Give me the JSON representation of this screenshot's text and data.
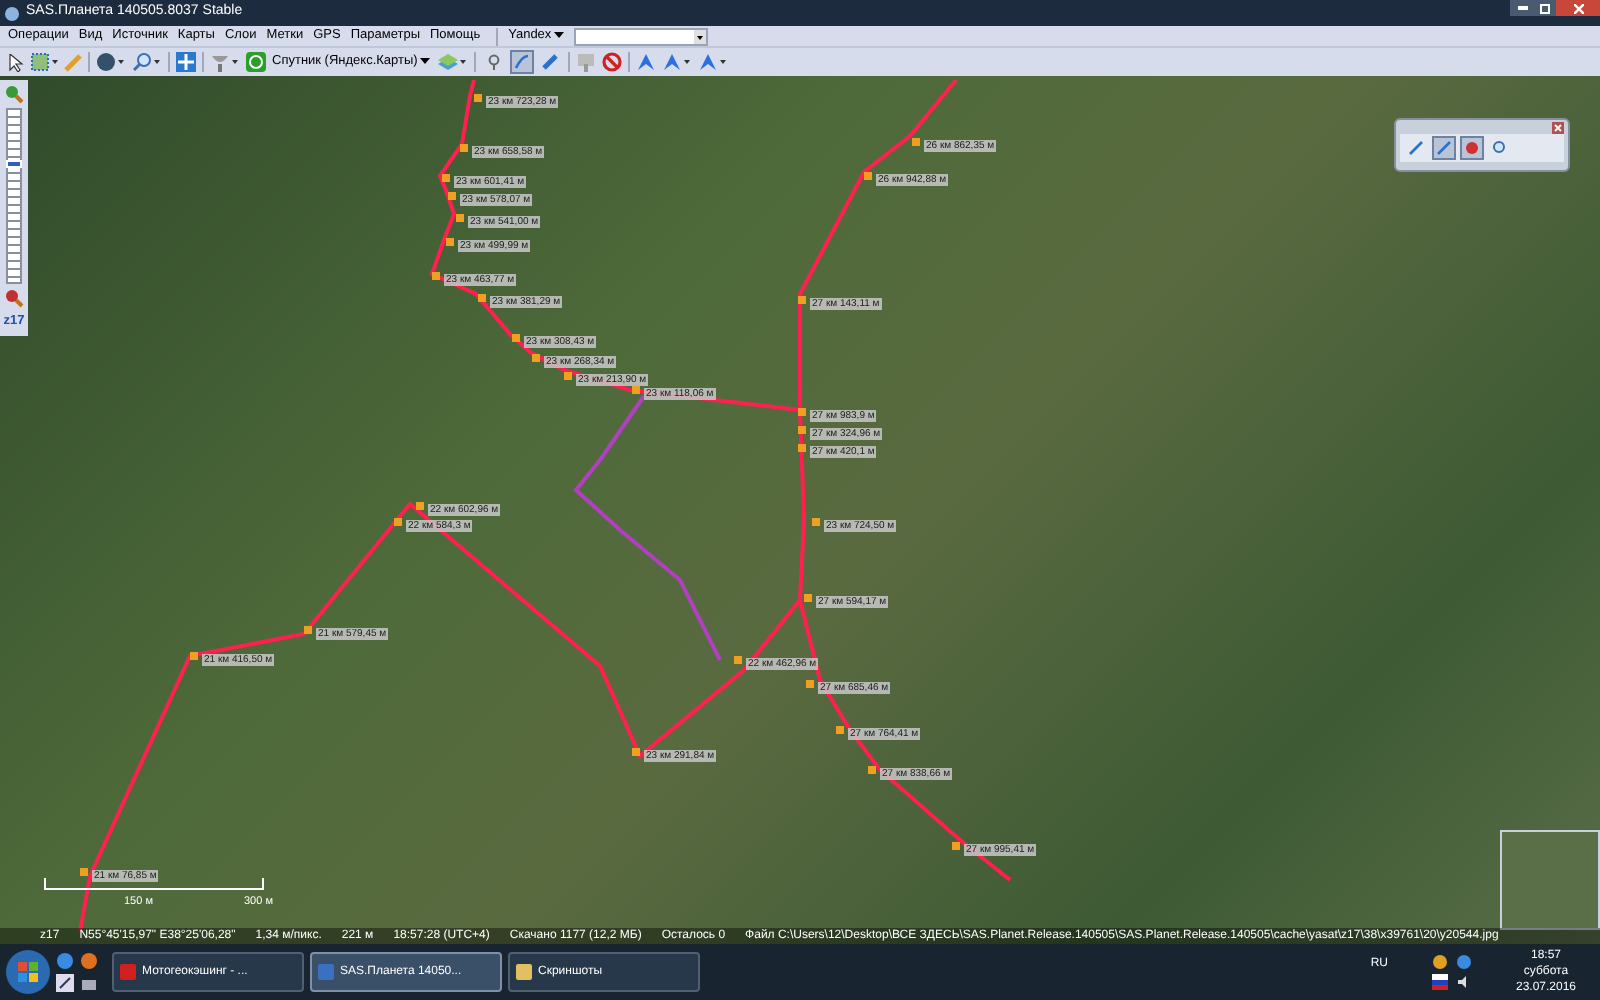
{
  "window": {
    "title": "SAS.Планета 140505.8037 Stable"
  },
  "menu": [
    "Операции",
    "Вид",
    "Источник",
    "Карты",
    "Слои",
    "Метки",
    "GPS",
    "Параметры",
    "Помощь"
  ],
  "search": {
    "provider": "Yandex"
  },
  "toolbar": {
    "map_source": "Спутник (Яндекс.Карты)",
    "tools": [
      {
        "selected": false
      },
      {
        "selected": true
      },
      {
        "selected": false
      }
    ]
  },
  "zoom": {
    "level": 0.7,
    "label": "z17"
  },
  "floating_toolbar": {
    "tools": [
      {
        "selected": false
      },
      {
        "selected": true
      },
      {
        "selected": true
      },
      {
        "selected": false
      }
    ]
  },
  "route_labels": [
    "23 км 723,28 м",
    "23 км 658,58 м",
    "23 км 601,41 м",
    "23 км 578,07 м",
    "23 км 541,00 м",
    "23 км 499,99 м",
    "23 км 463,77 м",
    "23 км 381,29 м",
    "23 км 308,43 м",
    "23 км 268,34 м",
    "23 км 213,90 м",
    "23 км 118,06 м",
    "26 км 862,35 м",
    "26 км 942,88 м",
    "27 км 143,11 м",
    "27 км 983,9 м",
    "27 км 324,96 м",
    "27 км 420,1 м",
    "23 км 724,50 м",
    "22 км 602,96 м",
    "22 км 584,3 м",
    "21 км 579,45 м",
    "21 км 416,50 м",
    "22 км 462,96 м",
    "27 км 594,17 м",
    "27 км 685,46 м",
    "27 км 764,41 м",
    "27 км 838,66 м",
    "27 км 995,41 м",
    "23 км 291,84 м",
    "21 км 76,85 м"
  ],
  "scale": [
    "150 м",
    "300 м"
  ],
  "status_bar": [
    "z17",
    "N55°45'15,97\" E38°25'06,28\"",
    "1,34 м/пикс.",
    "221 м",
    "18:57:28 (UTC+4)",
    "Скачано 1177 (12,2 МБ)",
    "Осталось 0",
    "Файл C:\\Users\\12\\Desktop\\ВСЕ ЗДЕСЬ\\SAS.Planet.Release.140505\\SAS.Planet.Release.140505\\cache\\yasat\\z17\\38\\x39761\\20\\y20544.jpg"
  ],
  "taskbar": {
    "windows": [
      {
        "title": "Мотогеокэшинг - ...",
        "selected": false
      },
      {
        "title": "SAS.Планета 14050...",
        "selected": true
      },
      {
        "title": "Скриншоты",
        "selected": false
      }
    ],
    "language": "RU",
    "time": "18:57",
    "weekday": "суббота",
    "date": "23.07.2016"
  }
}
